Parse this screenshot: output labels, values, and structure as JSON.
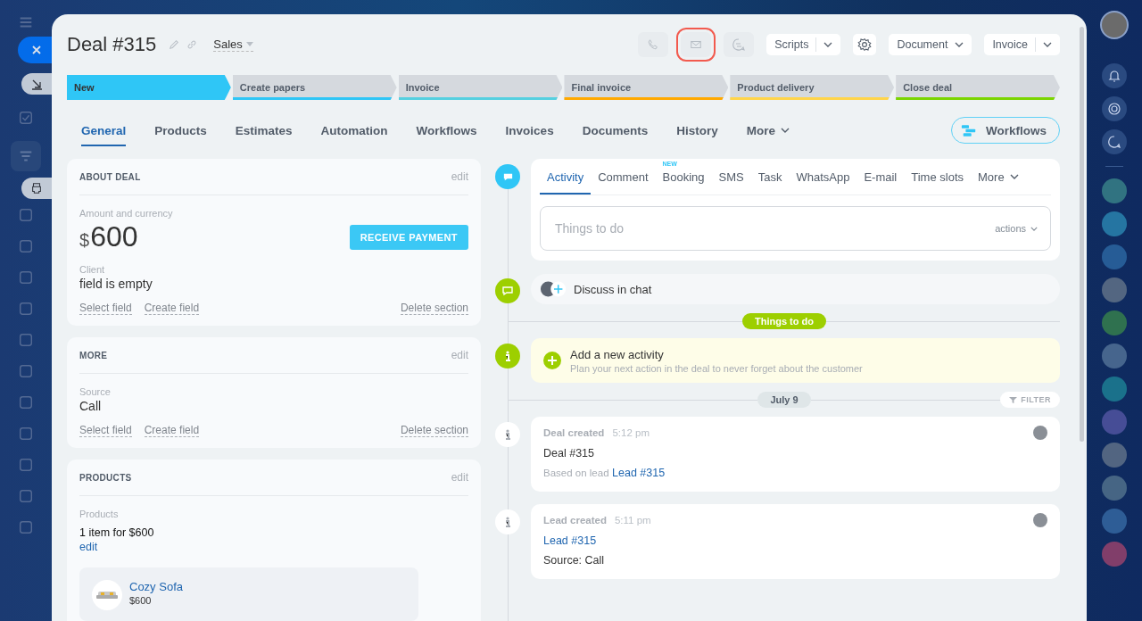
{
  "deal": {
    "title": "Deal #315",
    "pipeline": "Sales"
  },
  "header_actions": [
    {
      "kind": "phone",
      "highlighted": false
    },
    {
      "kind": "mail",
      "highlighted": true
    },
    {
      "kind": "chat",
      "highlighted": false
    }
  ],
  "header_buttons": [
    {
      "label": "Scripts",
      "kind": "split"
    },
    {
      "label": "Document",
      "kind": "dropdown"
    },
    {
      "label": "Invoice",
      "kind": "split"
    }
  ],
  "stages": [
    {
      "label": "New",
      "color": "#2fc6f6",
      "selected": true
    },
    {
      "label": "Create papers",
      "color": "#2fc6f6",
      "selected": false
    },
    {
      "label": "Invoice",
      "color": "#55d0e0",
      "selected": false
    },
    {
      "label": "Final invoice",
      "color": "#ffa900",
      "selected": false
    },
    {
      "label": "Product delivery",
      "color": "#ffd54a",
      "selected": false
    },
    {
      "label": "Close deal",
      "color": "#7bd500",
      "selected": false
    }
  ],
  "tabs": [
    {
      "label": "General",
      "kind": "tab",
      "selected": true
    },
    {
      "label": "Products",
      "kind": "tab",
      "selected": false
    },
    {
      "label": "Estimates",
      "kind": "tab",
      "selected": false
    },
    {
      "label": "Automation",
      "kind": "tab",
      "selected": false
    },
    {
      "label": "Workflows",
      "kind": "tab",
      "selected": false
    },
    {
      "label": "Invoices",
      "kind": "tab",
      "selected": false
    },
    {
      "label": "Documents",
      "kind": "tab",
      "selected": false
    },
    {
      "label": "History",
      "kind": "tab",
      "selected": false
    },
    {
      "label": "More",
      "kind": "menu",
      "selected": false
    }
  ],
  "workflows_button": {
    "label": "Workflows"
  },
  "sections": [
    {
      "title": "ABOUT DEAL",
      "edit": "edit",
      "fields": [
        {
          "kind": "money",
          "label": "Amount and currency",
          "currency": "$",
          "value": "600",
          "action": "RECEIVE PAYMENT"
        },
        {
          "kind": "text",
          "label": "Client",
          "value": "field is empty"
        }
      ],
      "links": [
        "Select field",
        "Create field"
      ],
      "delete": "Delete section"
    },
    {
      "title": "MORE",
      "edit": "edit",
      "fields": [
        {
          "kind": "text",
          "label": "Source",
          "value": "Call"
        }
      ],
      "links": [
        "Select field",
        "Create field"
      ],
      "delete": "Delete section"
    },
    {
      "title": "PRODUCTS",
      "edit": "edit",
      "fields": [
        {
          "kind": "products",
          "label": "Products",
          "value": "1 item for $600",
          "link": "edit",
          "items": [
            {
              "name": "Cozy Sofa",
              "price": "$600"
            }
          ]
        }
      ]
    }
  ],
  "composer": {
    "tabs": [
      {
        "label": "Activity",
        "selected": true
      },
      {
        "label": "Comment",
        "selected": false
      },
      {
        "label": "Booking",
        "badge": "NEW",
        "selected": false
      },
      {
        "label": "SMS",
        "selected": false
      },
      {
        "label": "Task",
        "selected": false
      },
      {
        "label": "WhatsApp",
        "selected": false
      },
      {
        "label": "E-mail",
        "selected": false
      },
      {
        "label": "Time slots",
        "selected": false
      },
      {
        "label": "More",
        "selected": false
      }
    ],
    "placeholder": "Things to do",
    "actions": "actions"
  },
  "chat": {
    "label": "Discuss in chat"
  },
  "todo_divider": "Things to do",
  "add_activity": {
    "title": "Add a new activity",
    "subtitle": "Plan your next action in the deal to never forget about the customer"
  },
  "date_divider": "July 9",
  "filter": "FILTER",
  "events": [
    {
      "title": "Deal created",
      "time": "5:12 pm",
      "lines": [
        {
          "kind": "text",
          "text": "Deal #315"
        },
        {
          "kind": "note",
          "text": "Based on lead",
          "link": "Lead #315"
        }
      ]
    },
    {
      "title": "Lead created",
      "time": "5:11 pm",
      "lines": [
        {
          "kind": "link",
          "link": "Lead #315"
        },
        {
          "kind": "text",
          "text": "Source: Call"
        }
      ]
    }
  ]
}
